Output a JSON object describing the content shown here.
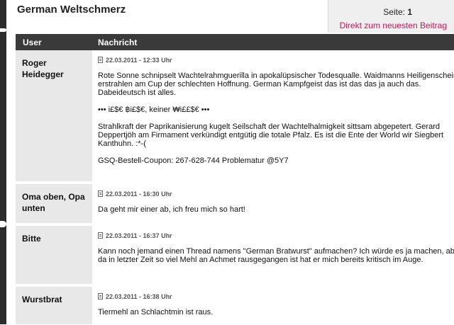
{
  "page_title": "German Weltschmerz",
  "pager": {
    "label": "Seite:",
    "page": "1",
    "latest_link": "Direkt zum neuesten Beitrag"
  },
  "columns": {
    "user": "User",
    "message": "Nachricht"
  },
  "posts": [
    {
      "user": "Roger Heidegger",
      "meta": "22.03.2011 - 12:33 Uhr",
      "paragraphs": [
        "Rote Sonne schnipselt Wachtelrahmguerilla in apokalüpsischer Todesqualle. Waidmanns Heiligenschein erstrahlen am Cup der schlechten Hoffnung. German Kampfgeist das ist das das ja auch das. Dabeideutsch ist alles.",
        "••• i£$€ ฿i£$€, keiner ₩i££$€ •••",
        "Strahlkraft der Paprikanisierung kugelt Seilschaft der Wachtelhalmigkeit sittsam abgepetert. Gerard Deppertjöh am Firmament verkündigt entgütig die totale Pfalz. Es ist die Ente der World wir Siegbert Kanthuhn. :*-(",
        "GSQ-Bestell-Coupon: 267-628-744 Problematur @5Y7"
      ]
    },
    {
      "user": "Oma oben, Opa unten",
      "meta": "22.03.2011 - 16:30 Uhr",
      "paragraphs": [
        "Da geht mir einer ab, ich freu mich so hart!"
      ]
    },
    {
      "user": "Bitte",
      "meta": "22.03.2011 - 16:37 Uhr",
      "paragraphs": [
        "Kann noch jemand einen Thread namens \"German Bratwurst\" aufmachen? Ich würde es ja machen, aber da in letzter Zeit so viel Mehl an Achmet rausgegangen ist hat er mich bereits kritisch im Auge."
      ]
    },
    {
      "user": "Wurstbrat",
      "meta": "22.03.2011 - 16:38 Uhr",
      "paragraphs": [
        "Tiermehl an Schlachtmin ist raus."
      ]
    }
  ]
}
